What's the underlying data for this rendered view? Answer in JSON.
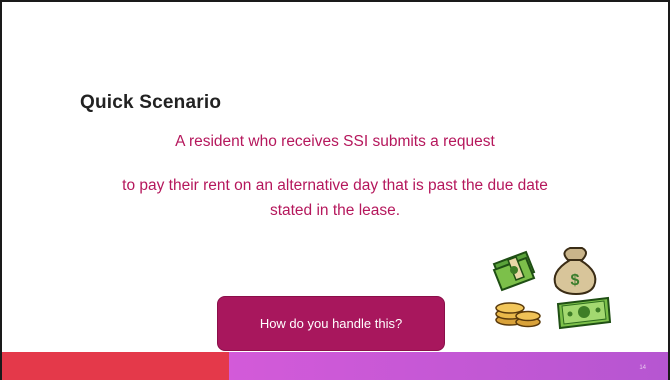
{
  "slide": {
    "title": "Quick Scenario",
    "body_lines": [
      "A resident who receives SSI submits a request",
      "to pay their rent on an alternative day that is past the due date",
      "stated in the lease."
    ],
    "cta_label": "How do you handle this?",
    "page_number": "14"
  },
  "colors": {
    "body_text": "#b5175c",
    "cta_background": "#a8175d",
    "footer_left": "#e4394a",
    "footer_right": "#c656d5"
  },
  "icons": [
    "cash-stack-icon",
    "money-bag-icon",
    "coin-stack-icon",
    "banknote-icon"
  ]
}
